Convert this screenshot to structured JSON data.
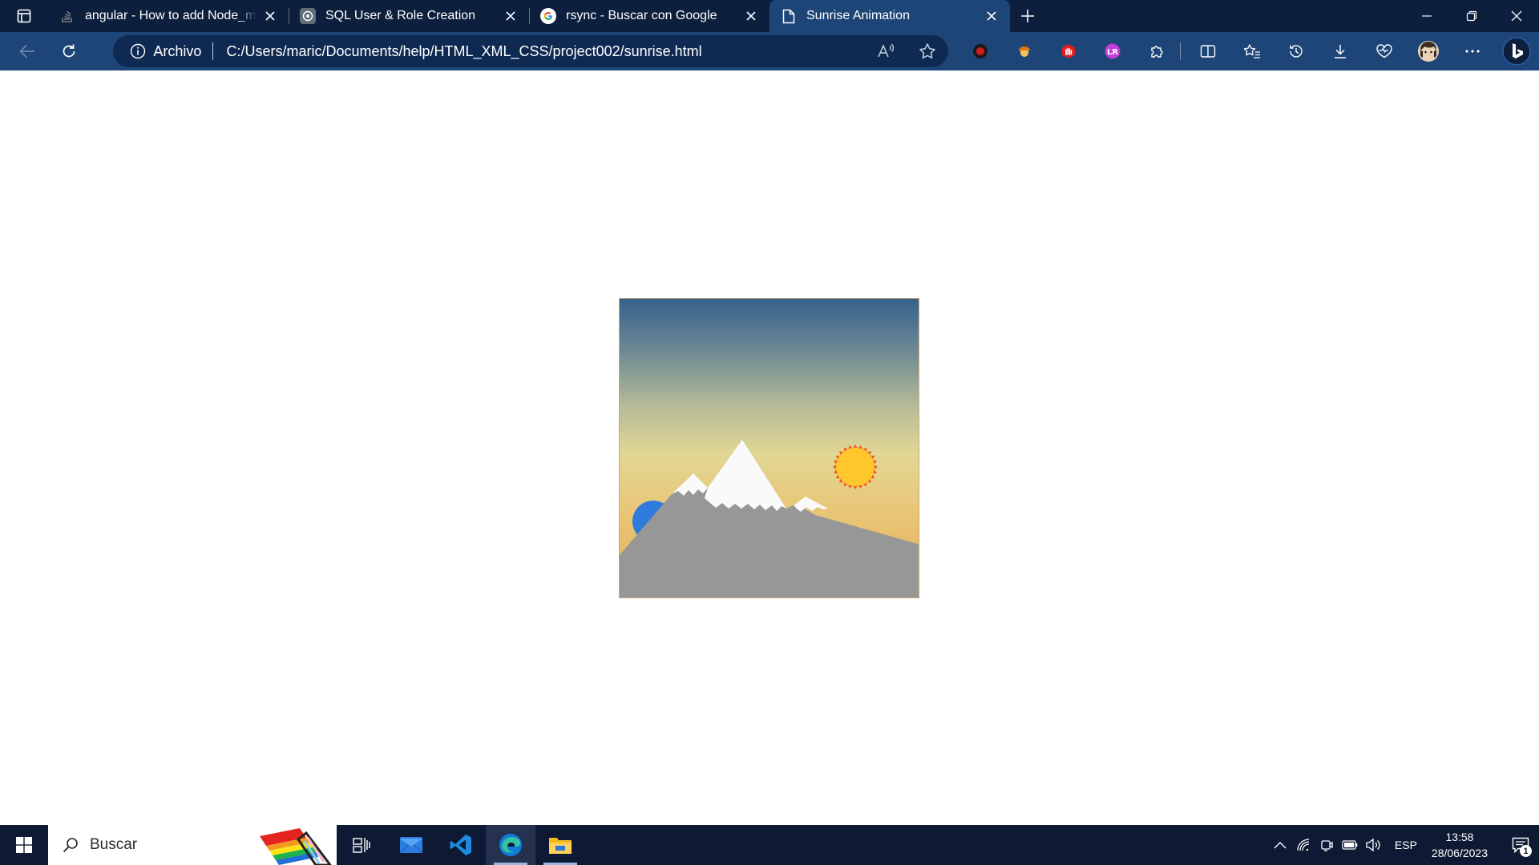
{
  "browser": {
    "tabs": [
      {
        "title": "angular - How to add Node_modules",
        "favicon": "stackoverflow-icon",
        "active": false
      },
      {
        "title": "SQL User & Role Creation",
        "favicon": "chatgpt-icon",
        "active": false
      },
      {
        "title": "rsync - Buscar con Google",
        "favicon": "google-icon",
        "active": false
      },
      {
        "title": "Sunrise Animation",
        "favicon": "page-icon",
        "active": true
      }
    ],
    "address_bar": {
      "site_label": "Archivo",
      "url": "C:/Users/maric/Documents/help/HTML_XML_CSS/project002/sunrise.html"
    },
    "toolbar_icons": [
      "read-aloud-icon",
      "favorite-star-icon",
      "extension-red-circle-icon",
      "extension-acorn-icon",
      "extension-red-hand-icon",
      "extension-lr-icon",
      "extensions-puzzle-icon",
      "split-screen-icon",
      "favorites-icon",
      "history-icon",
      "downloads-icon",
      "performance-icon",
      "profile-avatar",
      "more-menu-icon",
      "bing-copilot-icon"
    ]
  },
  "scene": {
    "sky_colors": [
      "#36628e",
      "#e2d794",
      "#e6ad5a"
    ],
    "sun_color": "#ffc72c",
    "sun_ray_color": "#f05a1e",
    "moon_color": "#2f7bdc",
    "mountain_color": "#979797",
    "snow_color": "#fafafa"
  },
  "taskbar": {
    "search_placeholder": "Buscar",
    "apps": [
      "task-view-icon",
      "mail-icon",
      "vscode-icon",
      "edge-icon",
      "file-explorer-icon"
    ],
    "tray": {
      "language": "ESP",
      "time": "13:58",
      "date": "28/06/2023",
      "notifications": "1"
    }
  }
}
